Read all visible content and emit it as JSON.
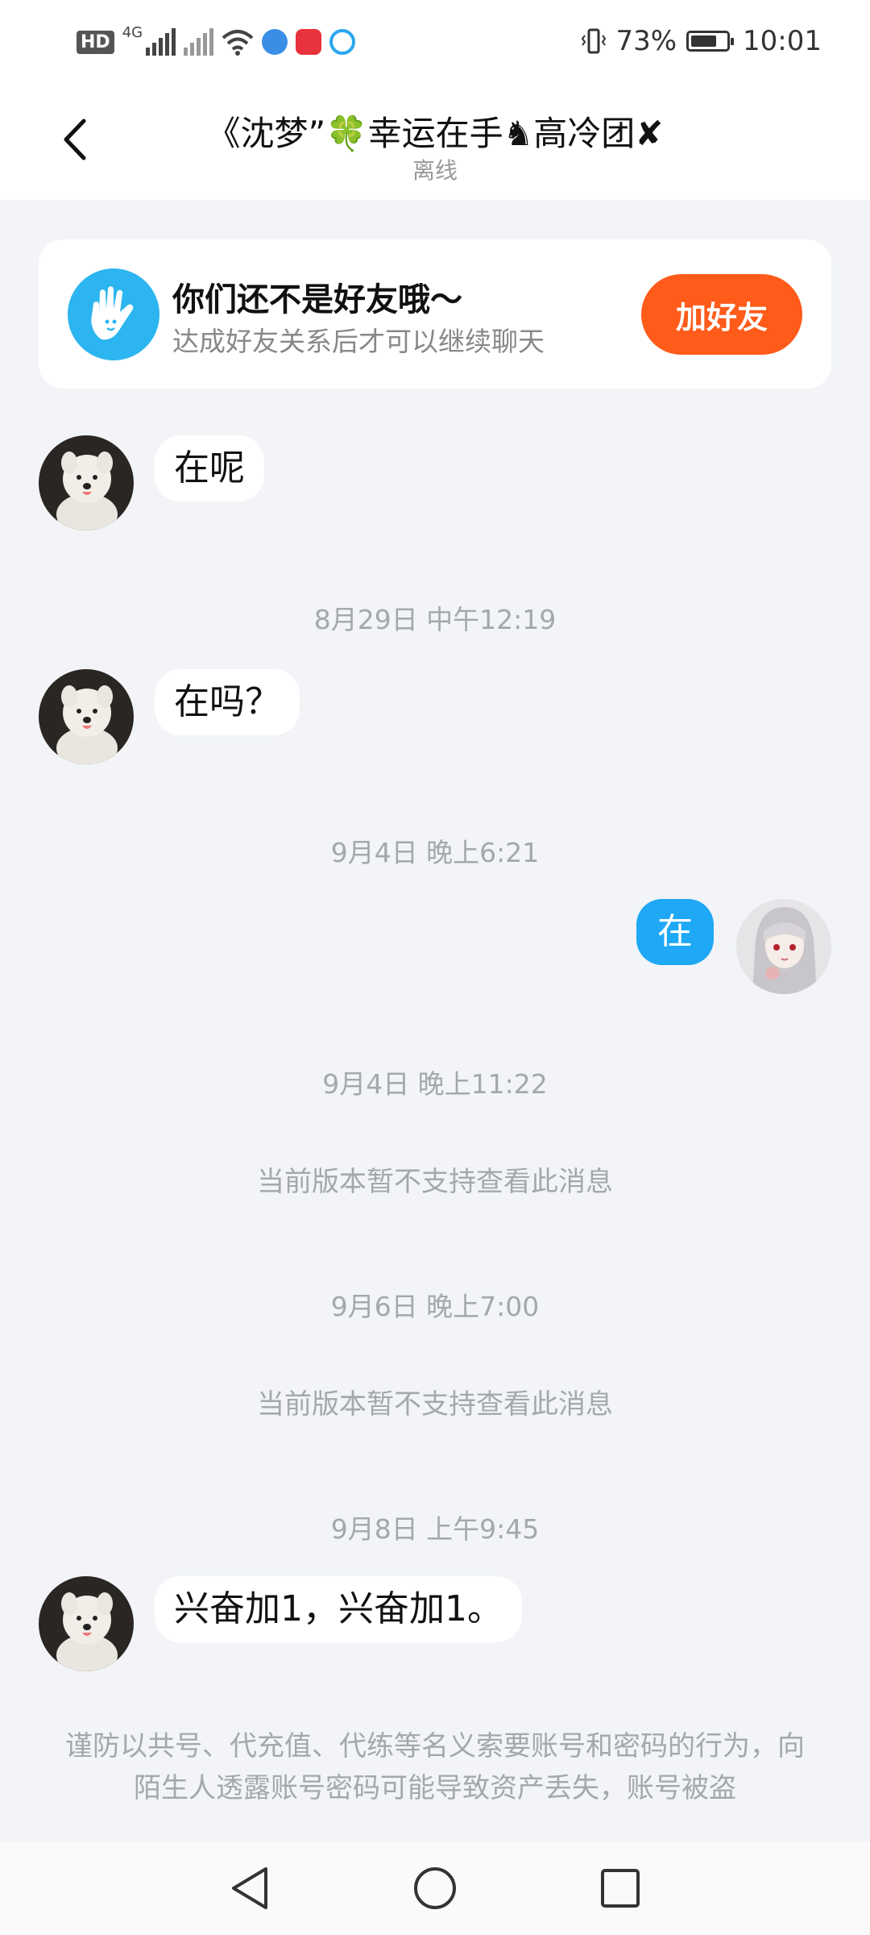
{
  "status_bar": {
    "hd_label": "HD",
    "network_label": "4G",
    "battery": "73%",
    "battery_level": 0.73,
    "time": "10:01",
    "icons": [
      "hd-icon",
      "signal-icon",
      "signal-no-service-icon",
      "wifi-icon",
      "browser-app-icon",
      "huawei-appgallery-icon",
      "chat-app-icon",
      "vibrate-icon",
      "battery-icon"
    ]
  },
  "header": {
    "title": "《沈梦”🍀幸运在手♞高冷团✘",
    "status": "离线",
    "back_icon": "chevron-left-icon"
  },
  "friend_banner": {
    "icon": "hand-wave-icon",
    "title": "你们还不是好友哦～",
    "subtitle": "达成好友关系后才可以继续聊天",
    "button_label": "加好友",
    "accent": "#ff5b1a"
  },
  "messages": [
    {
      "from": "other",
      "text": "在呢"
    },
    {
      "timestamp": "8月29日 中午12:19"
    },
    {
      "from": "other",
      "text": "在吗？"
    },
    {
      "timestamp": "9月4日 晚上6:21"
    },
    {
      "from": "me",
      "text": "在"
    },
    {
      "timestamp": "9月4日 晚上11:22"
    },
    {
      "system": "当前版本暂不支持查看此消息"
    },
    {
      "timestamp": "9月6日 晚上7:00"
    },
    {
      "system": "当前版本暂不支持查看此消息"
    },
    {
      "timestamp": "9月8日 上午9:45"
    },
    {
      "from": "other",
      "text": "兴奋加1，兴奋加1。"
    }
  ],
  "warning": "谨防以共号、代充值、代练等名义索要账号和密码的行为，向陌生人透露账号密码可能导致资产丢失，账号被盗",
  "nav_bar": {
    "icons": [
      "back-triangle-icon",
      "home-circle-icon",
      "recents-square-icon"
    ]
  },
  "colors": {
    "background": "#f2f4f7",
    "my_bubble": "#1ea8f5",
    "banner_icon": "#2cb5f0"
  }
}
